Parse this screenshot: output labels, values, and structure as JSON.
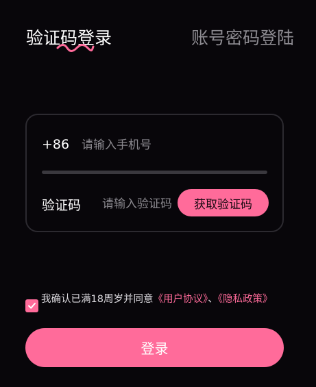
{
  "tabs": {
    "active_label": "验证码登录",
    "inactive_label": "账号密码登陆"
  },
  "form": {
    "country_code": "+86",
    "phone_placeholder": "请输入手机号",
    "code_label": "验证码",
    "code_placeholder": "请输入验证码",
    "get_code_label": "获取验证码"
  },
  "agreement": {
    "checked": true,
    "prefix": "我确认已满18周岁并同意",
    "user_agreement": "《用户协议》",
    "separator": "、",
    "privacy_policy": "《隐私政策》"
  },
  "login_label": "登录",
  "colors": {
    "background": "#08060a",
    "accent": "#ff6b9a",
    "muted_text": "#8c8a90",
    "card_border": "#2c2a30"
  },
  "icons": {
    "tab_indicator": "squiggle-underline-icon",
    "checkbox": "checkmark-icon"
  }
}
